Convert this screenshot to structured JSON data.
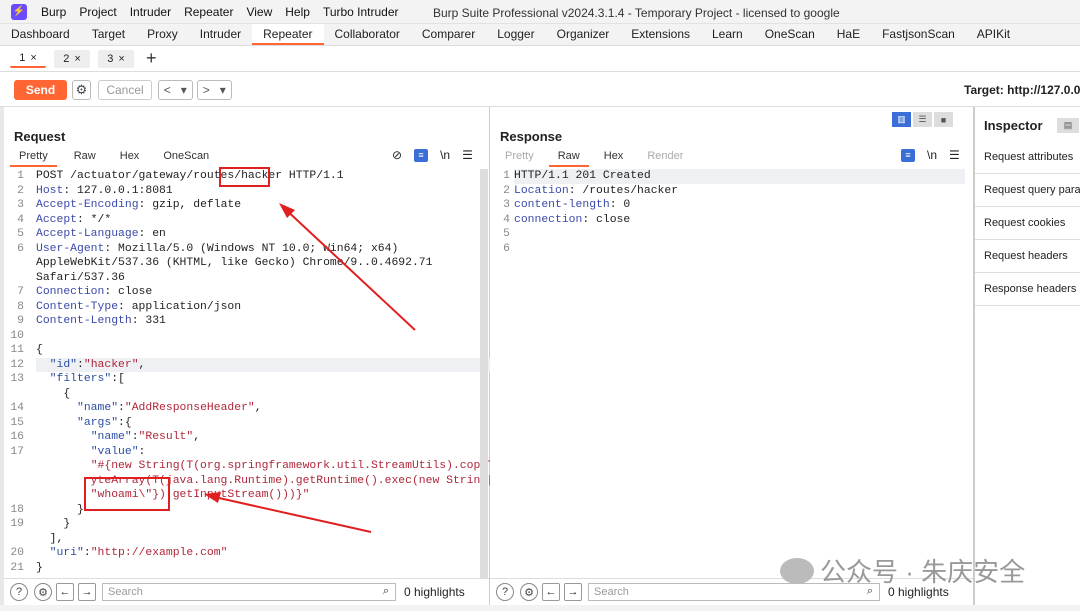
{
  "app": {
    "name": "Burp",
    "title": "Burp Suite Professional v2024.3.1.4 - Temporary Project - licensed to google"
  },
  "menu": [
    "Burp",
    "Project",
    "Intruder",
    "Repeater",
    "View",
    "Help",
    "Turbo Intruder"
  ],
  "tabs": [
    "Dashboard",
    "Target",
    "Proxy",
    "Intruder",
    "Repeater",
    "Collaborator",
    "Comparer",
    "Logger",
    "Organizer",
    "Extensions",
    "Learn",
    "OneScan",
    "HaE",
    "FastjsonScan",
    "APIKit"
  ],
  "active_tab": "Repeater",
  "subtabs": [
    {
      "label": "1",
      "close": "×"
    },
    {
      "label": "2",
      "close": "×"
    },
    {
      "label": "3",
      "close": "×"
    }
  ],
  "add_tab": "+",
  "toolbar": {
    "send": "Send",
    "cancel": "Cancel",
    "prev": "<",
    "prev_drop": "▾",
    "next": ">",
    "next_drop": "▾",
    "target": "Target: http://127.0.0"
  },
  "request": {
    "title": "Request",
    "views": [
      "Pretty",
      "Raw",
      "Hex",
      "OneScan"
    ],
    "active_view": "Pretty",
    "line_numbers": [
      "1",
      "2",
      "3",
      "4",
      "5",
      "6",
      "",
      "",
      "7",
      "8",
      "9",
      "10",
      "11",
      "12",
      "13",
      "",
      "14",
      "15",
      "16",
      "17",
      "",
      "",
      "",
      "18",
      "19",
      "",
      "20",
      "21"
    ],
    "search_placeholder": "Search",
    "highlights": "0 highlights"
  },
  "response": {
    "title": "Response",
    "views": [
      "Pretty",
      "Raw",
      "Hex",
      "Render"
    ],
    "active_view": "Raw",
    "line_numbers": [
      "1",
      "2",
      "3",
      "4",
      "5",
      "6"
    ],
    "search_placeholder": "Search",
    "highlights": "0 highlights"
  },
  "inspector": {
    "title": "Inspector",
    "items": [
      "Request attributes",
      "Request query parameters",
      "Request cookies",
      "Request headers",
      "Response headers"
    ]
  },
  "watermark": "公众号 · 朱庆安全",
  "colors": {
    "accent": "#ff6633",
    "annotation": "#e02020",
    "wrap_icon": "#3a6fd8"
  }
}
